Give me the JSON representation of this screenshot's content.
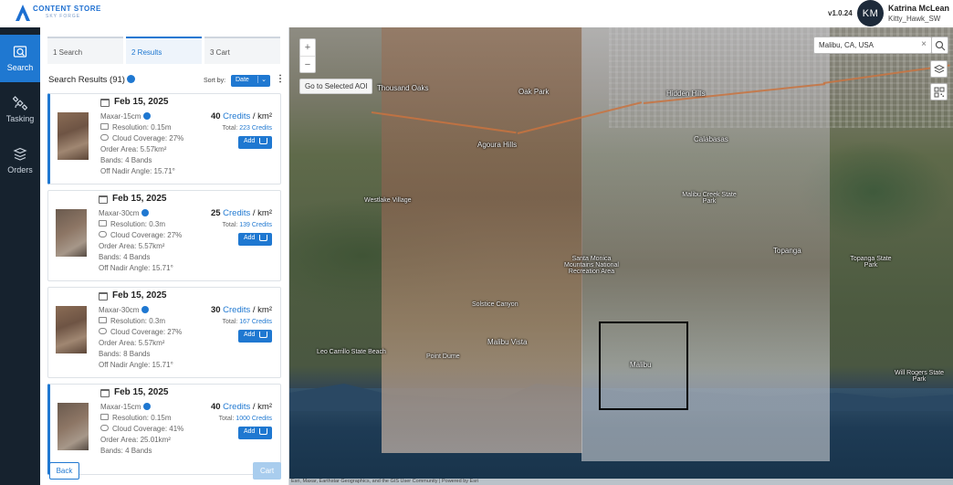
{
  "app": {
    "logo_line1": "CONTENT STORE",
    "logo_line2": "SKY FORGE",
    "version": "v1.0.24",
    "accent_color": "#1f78d1"
  },
  "user": {
    "initials": "KM",
    "name": "Katrina McLean",
    "handle": "Kitty_Hawk_SW"
  },
  "nav": [
    {
      "label": "Search",
      "icon": "search-image-icon",
      "active": true
    },
    {
      "label": "Tasking",
      "icon": "satellite-icon",
      "active": false
    },
    {
      "label": "Orders",
      "icon": "stack-icon",
      "active": false
    }
  ],
  "steps": [
    "1  Search",
    "2  Results",
    "3  Cart"
  ],
  "results": {
    "title": "Search Results (91)",
    "sort_label": "Sort by:",
    "sort_value": "Date",
    "cards": [
      {
        "date": "Feb 15, 2025",
        "sensor": "Maxar-15cm",
        "resolution": "Resolution: 0.15m",
        "cloud": "Cloud Coverage: 27%",
        "area": "Order Area: 5.57km²",
        "bands": "Bands: 4 Bands",
        "nadir": "Off Nadir Angle: 15.71°",
        "price_num": "40",
        "price_unit": "Credits",
        "price_per": " / km²",
        "total_label": "Total: ",
        "total_val": "223 Credits",
        "add": "Add"
      },
      {
        "date": "Feb 15, 2025",
        "sensor": "Maxar-30cm",
        "resolution": "Resolution: 0.3m",
        "cloud": "Cloud Coverage: 27%",
        "area": "Order Area: 5.57km²",
        "bands": "Bands: 4 Bands",
        "nadir": "Off Nadir Angle: 15.71°",
        "price_num": "25",
        "price_unit": "Credits",
        "price_per": " / km²",
        "total_label": "Total: ",
        "total_val": "139 Credits",
        "add": "Add"
      },
      {
        "date": "Feb 15, 2025",
        "sensor": "Maxar-30cm",
        "resolution": "Resolution: 0.3m",
        "cloud": "Cloud Coverage: 27%",
        "area": "Order Area: 5.57km²",
        "bands": "Bands: 8 Bands",
        "nadir": "Off Nadir Angle: 15.71°",
        "price_num": "30",
        "price_unit": "Credits",
        "price_per": " / km²",
        "total_label": "Total: ",
        "total_val": "167 Credits",
        "add": "Add"
      },
      {
        "date": "Feb 15, 2025",
        "sensor": "Maxar-15cm",
        "resolution": "Resolution: 0.15m",
        "cloud": "Cloud Coverage: 41%",
        "area": "Order Area: 25.01km²",
        "bands": "Bands: 4 Bands",
        "nadir": "",
        "price_num": "40",
        "price_unit": "Credits",
        "price_per": " / km²",
        "total_label": "Total: ",
        "total_val": "1000 Credits",
        "add": "Add"
      }
    ],
    "back": "Back",
    "cart": "Cart"
  },
  "map": {
    "zoom_in": "+",
    "zoom_out": "−",
    "goto": "Go to Selected AOI",
    "search_value": "Malibu, CA, USA",
    "labels": [
      {
        "text": "Thousand Oaks",
        "name": "label-thousand-oaks"
      },
      {
        "text": "Oak Park",
        "name": "label-oak-park"
      },
      {
        "text": "Agoura Hills",
        "name": "label-agoura-hills"
      },
      {
        "text": "Hidden Hills",
        "name": "label-hidden-hills"
      },
      {
        "text": "Calabasas",
        "name": "label-calabasas"
      },
      {
        "text": "Westlake Village",
        "name": "label-westlake-village"
      },
      {
        "text": "Topanga",
        "name": "label-topanga"
      },
      {
        "text": "Malibu",
        "name": "label-malibu"
      },
      {
        "text": "Malibu Vista",
        "name": "label-malibu-vista"
      },
      {
        "text": "Solstice Canyon",
        "name": "label-solstice-canyon"
      },
      {
        "text": "Santa Monica Mountains National Recreation Area",
        "name": "label-smmnra"
      },
      {
        "text": "Point Dume",
        "name": "label-point-dume"
      },
      {
        "text": "Topanga State Park",
        "name": "label-topanga-sp"
      },
      {
        "text": "Will Rogers State Park",
        "name": "label-will-rogers"
      },
      {
        "text": "Malibu Creek State Park",
        "name": "label-malibu-creek-sp"
      },
      {
        "text": "Leo Carrillo State Beach",
        "name": "label-leo-carrillo"
      }
    ],
    "attribution": "Esri, Maxar, Earthstar Geographics, and the GIS User Community | Powered by Esri"
  }
}
